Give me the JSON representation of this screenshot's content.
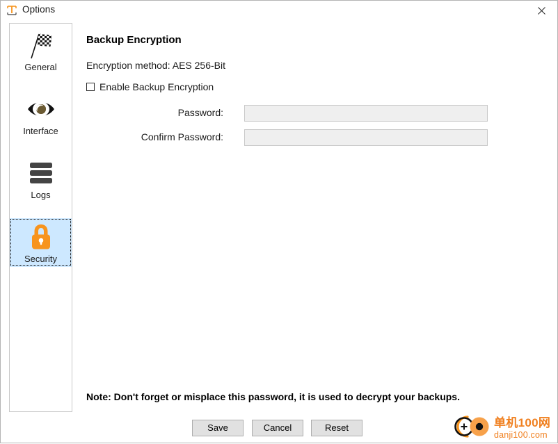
{
  "window": {
    "title": "Options",
    "app_icon": "text-tool-icon",
    "close_icon": "close-icon"
  },
  "sidebar": {
    "items": [
      {
        "id": "general",
        "label": "General",
        "icon": "checkered-flag-icon",
        "selected": false
      },
      {
        "id": "interface",
        "label": "Interface",
        "icon": "eye-icon",
        "selected": false
      },
      {
        "id": "logs",
        "label": "Logs",
        "icon": "list-lines-icon",
        "selected": false
      },
      {
        "id": "security",
        "label": "Security",
        "icon": "padlock-icon",
        "selected": true
      }
    ]
  },
  "main": {
    "section_title": "Backup Encryption",
    "encryption_method": "Encryption method: AES 256-Bit",
    "enable_checkbox": {
      "label": "Enable Backup Encryption",
      "checked": false
    },
    "fields": [
      {
        "id": "password",
        "label": "Password:",
        "value": "",
        "placeholder": "",
        "disabled": true
      },
      {
        "id": "confirm-password",
        "label": "Confirm Password:",
        "value": "",
        "placeholder": "",
        "disabled": true
      }
    ],
    "note": "Note: Don't forget or misplace this password, it is used to decrypt your backups."
  },
  "buttons": {
    "save": "Save",
    "cancel": "Cancel",
    "reset": "Reset"
  },
  "watermark": {
    "line1": "单机100网",
    "line2": "danji100.com"
  },
  "colors": {
    "accent_orange": "#f7941e",
    "selection_blue": "#cde8ff",
    "field_disabled_bg": "#efefef",
    "button_bg": "#e1e1e1",
    "watermark_orange": "#f08020"
  }
}
